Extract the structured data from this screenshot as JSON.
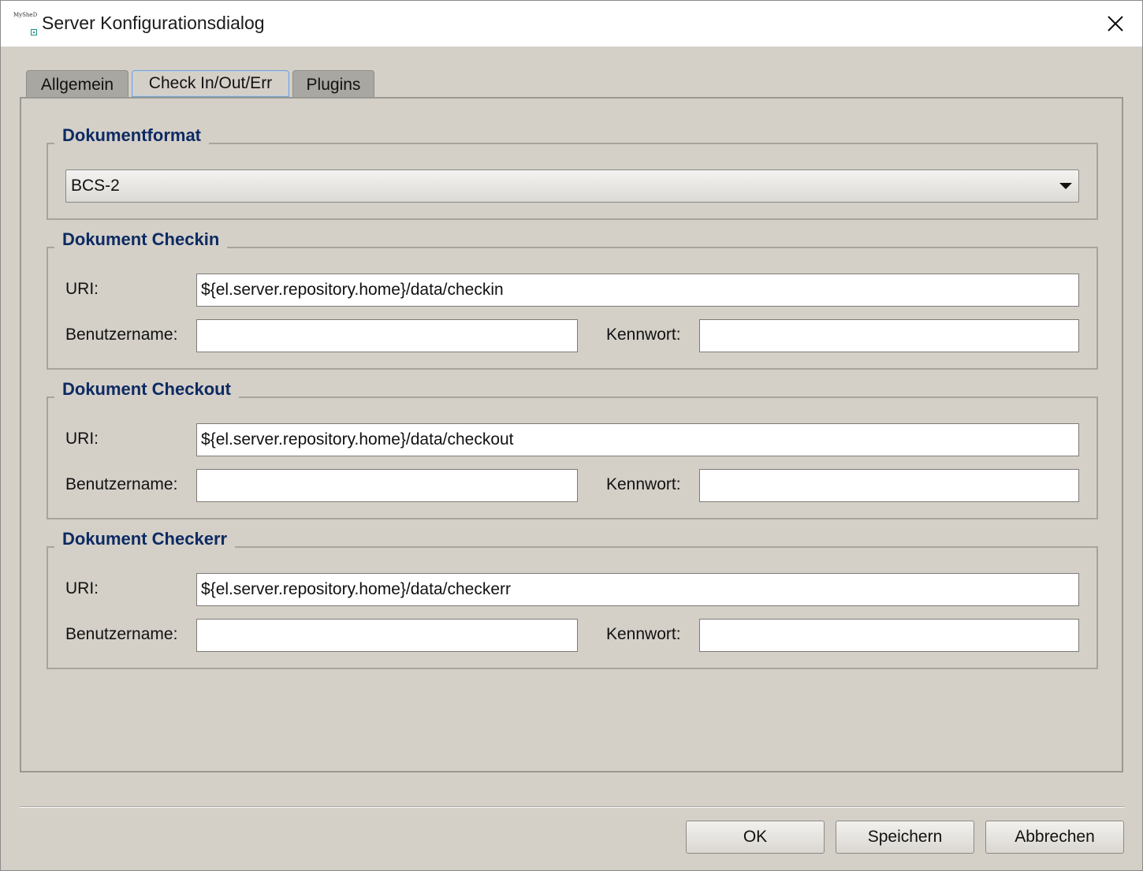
{
  "window": {
    "title": "Server Konfigurationsdialog",
    "icon_text": "MySheD"
  },
  "tabs": [
    {
      "label": "Allgemein",
      "active": false
    },
    {
      "label": "Check In/Out/Err",
      "active": true
    },
    {
      "label": "Plugins",
      "active": false
    }
  ],
  "dokumentformat": {
    "title": "Dokumentformat",
    "selected": "BCS-2"
  },
  "checkin": {
    "title": "Dokument Checkin",
    "uri_label": "URI:",
    "uri_value": "${el.server.repository.home}/data/checkin",
    "user_label": "Benutzername:",
    "user_value": "",
    "pass_label": "Kennwort:",
    "pass_value": ""
  },
  "checkout": {
    "title": "Dokument Checkout",
    "uri_label": "URI:",
    "uri_value": "${el.server.repository.home}/data/checkout",
    "user_label": "Benutzername:",
    "user_value": "",
    "pass_label": "Kennwort:",
    "pass_value": ""
  },
  "checkerr": {
    "title": "Dokument Checkerr",
    "uri_label": "URI:",
    "uri_value": "${el.server.repository.home}/data/checkerr",
    "user_label": "Benutzername:",
    "user_value": "",
    "pass_label": "Kennwort:",
    "pass_value": ""
  },
  "buttons": {
    "ok": "OK",
    "save": "Speichern",
    "cancel": "Abbrechen"
  },
  "colors": {
    "group_title": "#0d2a63",
    "dialog_bg": "#d4d0c8",
    "active_tab_border": "#7aa0c8"
  }
}
